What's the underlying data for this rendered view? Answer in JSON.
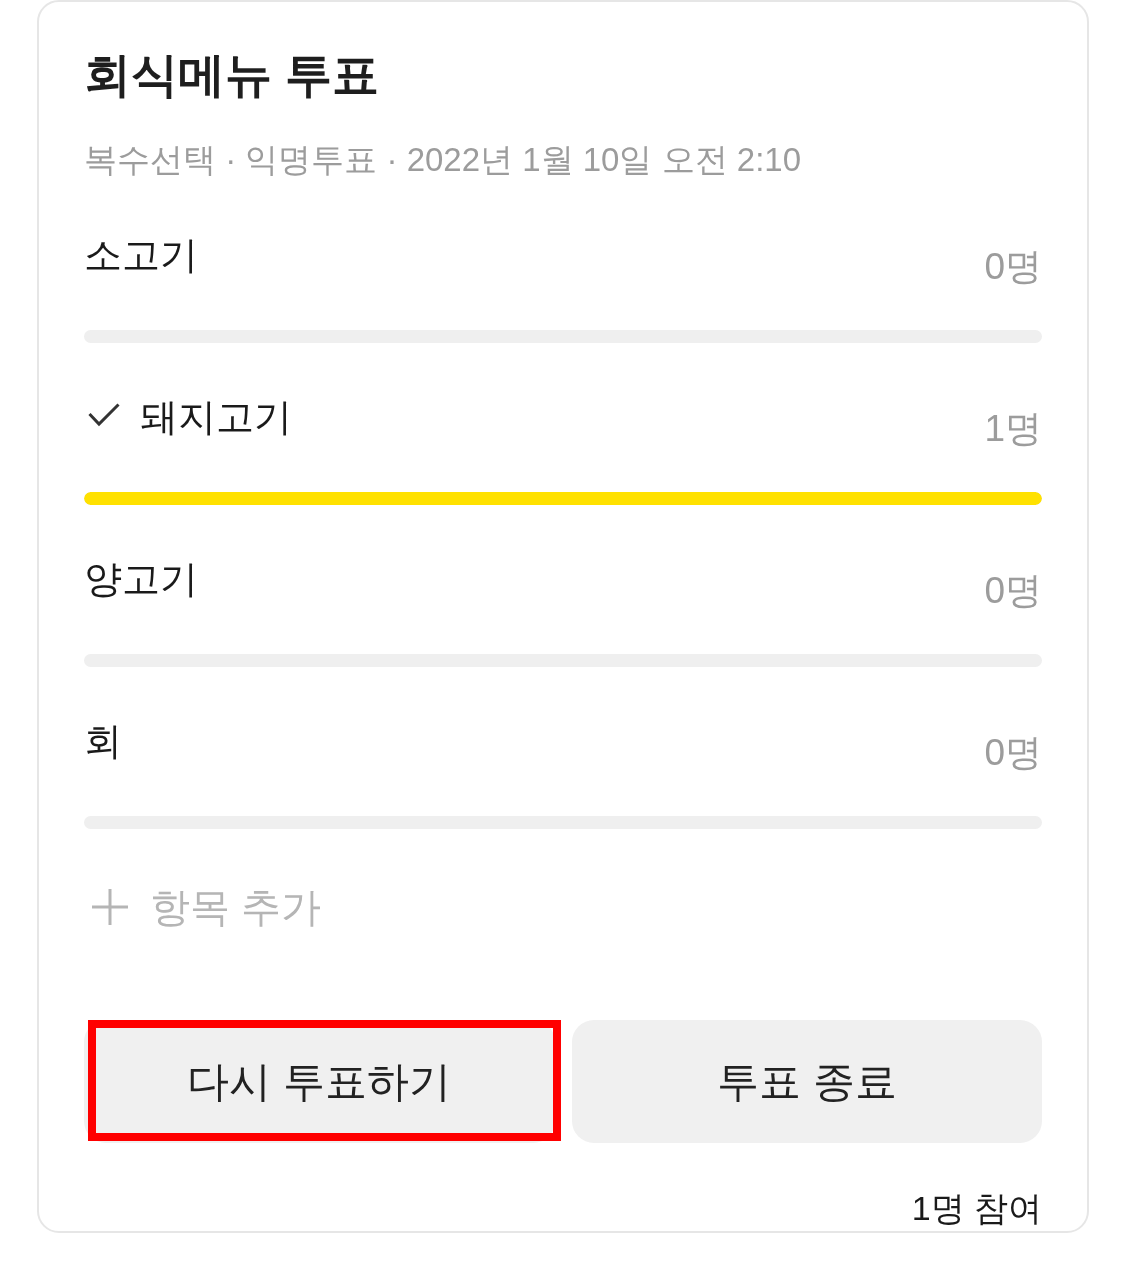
{
  "poll": {
    "title": "회식메뉴 투표",
    "meta": "복수선택 · 익명투표 · 2022년 1월 10일 오전 2:10"
  },
  "options": [
    {
      "label": "소고기",
      "count": "0명",
      "voted": false,
      "level": 0
    },
    {
      "label": "돼지고기",
      "count": "1명",
      "voted": true,
      "level": 1
    },
    {
      "label": "양고기",
      "count": "0명",
      "voted": false,
      "level": 0
    },
    {
      "label": "회",
      "count": "0명",
      "voted": false,
      "level": 0
    }
  ],
  "add_item": {
    "label": "항목 추가"
  },
  "buttons": [
    {
      "label": "다시 투표하기",
      "highlighted": true
    },
    {
      "label": "투표 종료",
      "highlighted": false
    }
  ],
  "footer": {
    "participants": "1명 참여"
  }
}
